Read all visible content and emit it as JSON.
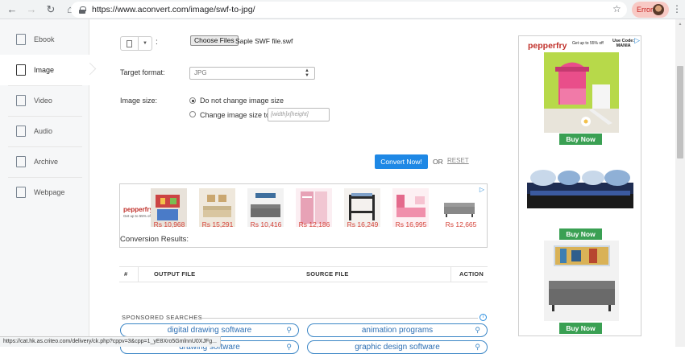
{
  "browser": {
    "url": "https://www.aconvert.com/image/swf-to-jpg/",
    "error_label": "Error",
    "status_url": "https://cat.hk.as.criteo.com/delivery/ck.php?cppv=3&cpp=1_yE8Xro5GmlnnU0XJFg..."
  },
  "sidebar": {
    "items": [
      {
        "label": "Ebook",
        "icon": "ebook-icon"
      },
      {
        "label": "Image",
        "icon": "image-icon",
        "active": true
      },
      {
        "label": "Video",
        "icon": "video-icon"
      },
      {
        "label": "Audio",
        "icon": "audio-icon"
      },
      {
        "label": "Archive",
        "icon": "archive-icon"
      },
      {
        "label": "Webpage",
        "icon": "webpage-icon"
      }
    ]
  },
  "form": {
    "colon": ":",
    "choose_files": "Choose Files",
    "file_name": "Saple SWF file.swf",
    "target_format_label": "Target format:",
    "target_format_value": "JPG",
    "image_size_label": "Image size:",
    "opt_no_change": "Do not change image size",
    "opt_change": "Change image size to:",
    "size_placeholder": "[width]x[height]",
    "convert_button": "Convert Now!",
    "or_text": "OR",
    "reset": "RESET"
  },
  "ad_strip": {
    "brand": "pepperfry",
    "brand_sub": "Get up to 55% off",
    "prices": [
      "Rs 10,968",
      "Rs 15,291",
      "Rs 10,416",
      "Rs 12,186",
      "Rs 16,249",
      "Rs 16,995",
      "Rs 12,665"
    ]
  },
  "results": {
    "title": "Conversion Results:",
    "columns": [
      "#",
      "OUTPUT FILE",
      "SOURCE FILE",
      "ACTION"
    ]
  },
  "sponsored": {
    "title": "SPONSORED SEARCHES",
    "searches": [
      "digital drawing software",
      "animation programs",
      "drawing software",
      "graphic design software"
    ]
  },
  "side_ad": {
    "brand": "pepperfry",
    "offer_line1": "Get up to 55% off",
    "code_line1": "Use Code:",
    "code_line2": "MANIA",
    "buy_now": "Buy Now"
  },
  "colors": {
    "accent": "#1e88e5",
    "brand_red": "#c0302a",
    "buy_green": "#3aa053",
    "price_red": "#d5453b"
  }
}
